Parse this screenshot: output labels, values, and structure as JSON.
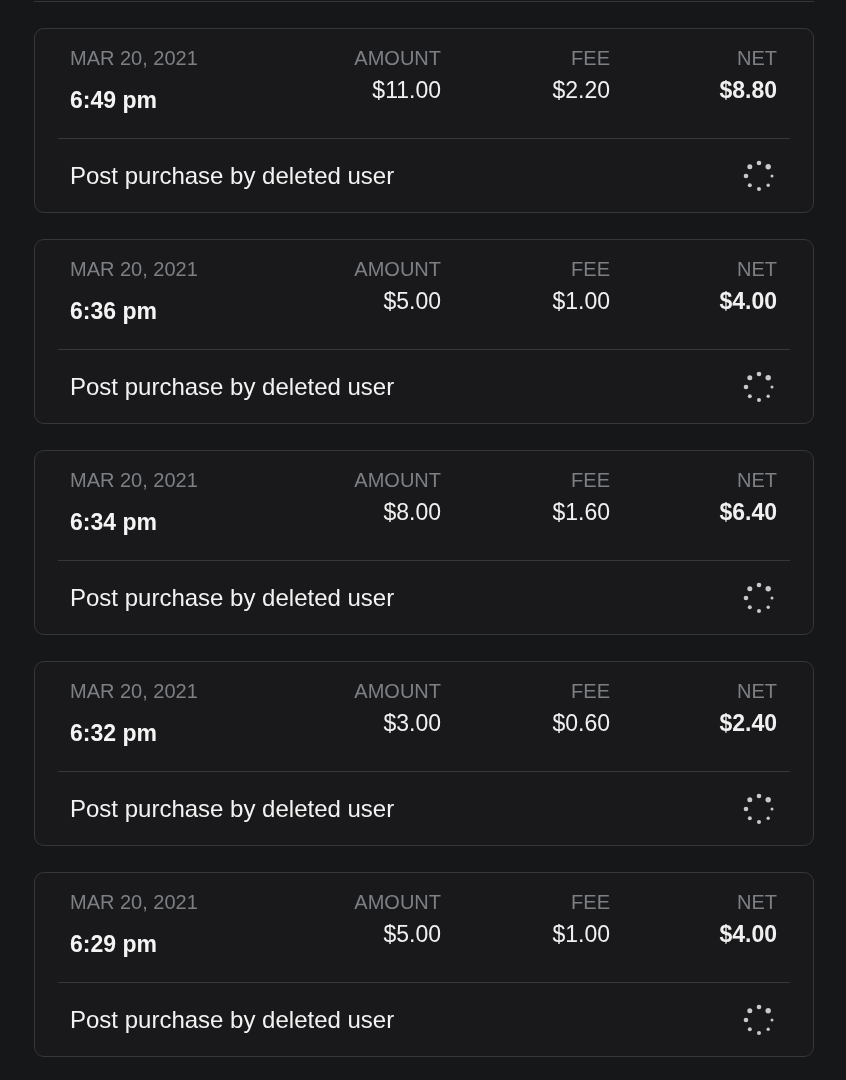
{
  "transactions": [
    {
      "date": "MAR 20, 2021",
      "time": "6:49 pm",
      "amount_label": "AMOUNT",
      "amount": "$11.00",
      "fee_label": "FEE",
      "fee": "$2.20",
      "net_label": "NET",
      "net": "$8.80",
      "description": "Post purchase by deleted user"
    },
    {
      "date": "MAR 20, 2021",
      "time": "6:36 pm",
      "amount_label": "AMOUNT",
      "amount": "$5.00",
      "fee_label": "FEE",
      "fee": "$1.00",
      "net_label": "NET",
      "net": "$4.00",
      "description": "Post purchase by deleted user"
    },
    {
      "date": "MAR 20, 2021",
      "time": "6:34 pm",
      "amount_label": "AMOUNT",
      "amount": "$8.00",
      "fee_label": "FEE",
      "fee": "$1.60",
      "net_label": "NET",
      "net": "$6.40",
      "description": "Post purchase by deleted user"
    },
    {
      "date": "MAR 20, 2021",
      "time": "6:32 pm",
      "amount_label": "AMOUNT",
      "amount": "$3.00",
      "fee_label": "FEE",
      "fee": "$0.60",
      "net_label": "NET",
      "net": "$2.40",
      "description": "Post purchase by deleted user"
    },
    {
      "date": "MAR 20, 2021",
      "time": "6:29 pm",
      "amount_label": "AMOUNT",
      "amount": "$5.00",
      "fee_label": "FEE",
      "fee": "$1.00",
      "net_label": "NET",
      "net": "$4.00",
      "description": "Post purchase by deleted user"
    }
  ]
}
